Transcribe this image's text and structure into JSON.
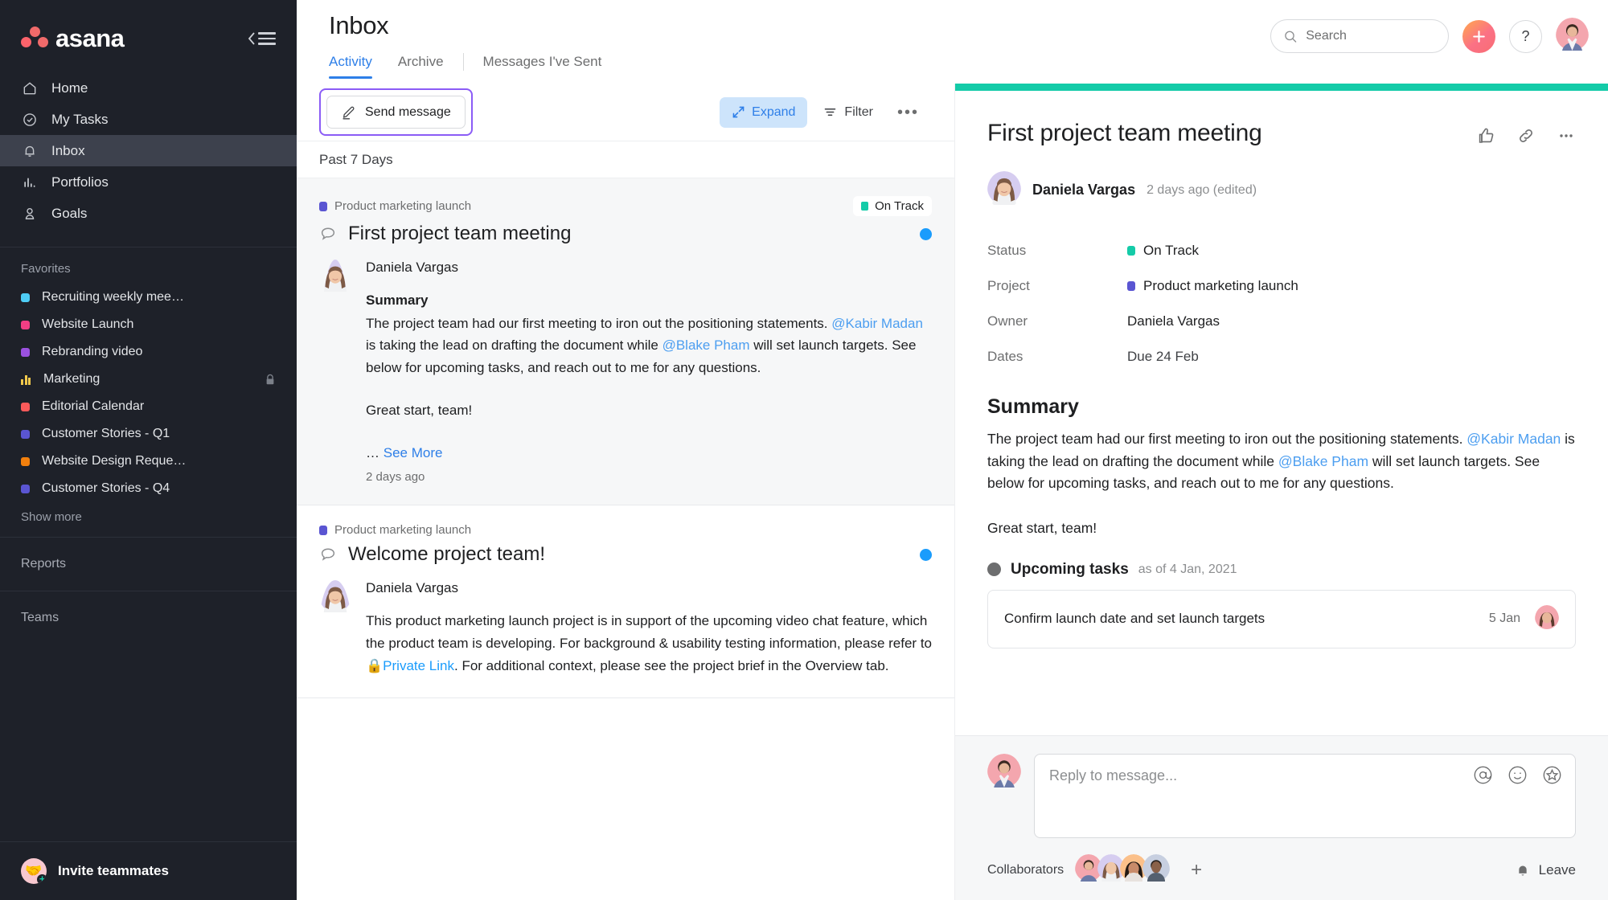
{
  "brand": {
    "name": "asana",
    "accent": "#f06a6a"
  },
  "sidebar": {
    "collapse_label": "Collapse sidebar",
    "nav": [
      {
        "label": "Home",
        "icon": "home-icon"
      },
      {
        "label": "My Tasks",
        "icon": "check-circle-icon"
      },
      {
        "label": "Inbox",
        "icon": "bell-icon",
        "active": true
      },
      {
        "label": "Portfolios",
        "icon": "bar-chart-icon"
      },
      {
        "label": "Goals",
        "icon": "goal-icon"
      }
    ],
    "favorites_label": "Favorites",
    "favorites": [
      {
        "label": "Recruiting weekly mee…",
        "color": "#4ecdf5",
        "type": "dot"
      },
      {
        "label": "Website Launch",
        "color": "#f23e84",
        "type": "dot"
      },
      {
        "label": "Rebranding video",
        "color": "#9b51e0",
        "type": "dot"
      },
      {
        "label": "Marketing",
        "color": "#f2c94c",
        "type": "bars",
        "locked": true
      },
      {
        "label": "Editorial Calendar",
        "color": "#fb5a5a",
        "type": "dot"
      },
      {
        "label": "Customer Stories - Q1",
        "color": "#5a55d2",
        "type": "dot"
      },
      {
        "label": "Website Design Reque…",
        "color": "#f2800d",
        "type": "dot"
      },
      {
        "label": "Customer Stories - Q4",
        "color": "#5a55d2",
        "type": "dot"
      }
    ],
    "show_more": "Show more",
    "reports_label": "Reports",
    "teams_label": "Teams",
    "invite_label": "Invite teammates"
  },
  "header": {
    "title": "Inbox",
    "tabs": [
      {
        "label": "Activity",
        "active": true
      },
      {
        "label": "Archive",
        "active": false
      },
      {
        "label": "Messages I've Sent",
        "active": false
      }
    ],
    "search_placeholder": "Search",
    "search_value": "",
    "plus_label": "+",
    "help_label": "?"
  },
  "toolbar": {
    "send_message": "Send message",
    "expand": "Expand",
    "filter": "Filter",
    "more": "•••"
  },
  "list": {
    "section_header": "Past 7 Days",
    "items": [
      {
        "project": "Product marketing launch",
        "project_color": "#5a55d2",
        "status": "On Track",
        "status_color": "#14cba8",
        "title": "First project team meeting",
        "author": "Daniela Vargas",
        "subheading": "Summary",
        "body_1": "The project team had our first meeting to iron out the positioning statements. ",
        "mention_1": "@Kabir Madan",
        "body_2": " is taking the lead on drafting the document while ",
        "mention_2": "@Blake Pham",
        "body_3": " will set launch targets. See below for upcoming tasks, and reach out to me for any questions.",
        "body_4": "Great start, team!",
        "see_more_ellipsis": "… ",
        "see_more": "See More",
        "timestamp": "2 days ago",
        "unread": true,
        "selected": true
      },
      {
        "project": "Product marketing launch",
        "project_color": "#5a55d2",
        "status": "",
        "title": "Welcome project team!",
        "author": "Daniela Vargas",
        "body_1": "This product marketing launch project is in support of the upcoming video chat feature, which the product team is developing. For background & usability testing information, please refer to ",
        "link_1": "Private Link",
        "body_2": ". For additional context, please see the project brief in the Overview tab.",
        "unread": true,
        "selected": false
      }
    ]
  },
  "detail": {
    "accent_color": "#14cba8",
    "title": "First project team meeting",
    "actions": {
      "like": "Like",
      "copy_link": "Copy link",
      "more": "More actions"
    },
    "author": "Daniela Vargas",
    "author_meta": "2 days ago (edited)",
    "meta": [
      {
        "key": "Status",
        "value": "On Track",
        "swatch": "#14cba8"
      },
      {
        "key": "Project",
        "value": "Product marketing launch",
        "swatch": "#5a55d2"
      },
      {
        "key": "Owner",
        "value": "Daniela Vargas",
        "swatch": ""
      },
      {
        "key": "Dates",
        "value": "Due 24 Feb",
        "swatch": ""
      }
    ],
    "summary_heading": "Summary",
    "summary_1": "The project team had our first meeting to iron out the positioning statements. ",
    "summary_mention_1": "@Kabir Madan",
    "summary_2": " is taking the lead on drafting the document while ",
    "summary_mention_2": "@Blake Pham",
    "summary_3": " will set launch targets. See below for upcoming tasks, and reach out to me for any questions.",
    "summary_4": "Great start, team!",
    "upcoming_title": "Upcoming tasks",
    "upcoming_sub": "as of 4 Jan, 2021",
    "task_name": "Confirm launch date and set launch targets",
    "task_date": "5 Jan"
  },
  "reply": {
    "placeholder": "Reply to message...",
    "value": "",
    "mention_icon": "at-icon",
    "emoji_icon": "smiley-icon",
    "sticker_icon": "star-icon",
    "collaborators_label": "Collaborators",
    "add_collaborator": "+",
    "leave_label": "Leave"
  }
}
